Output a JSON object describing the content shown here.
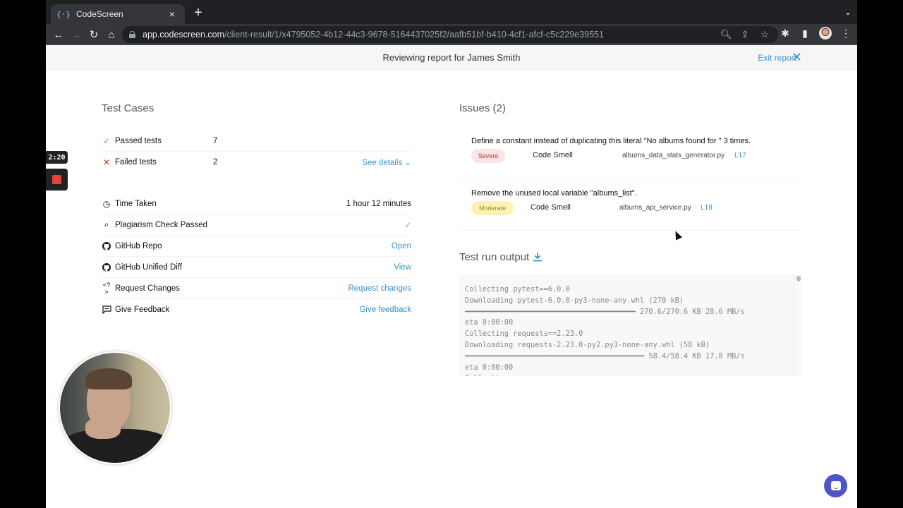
{
  "browser": {
    "tab": {
      "favicon": "{·}",
      "title": "CodeScreen"
    },
    "url_host": "app.codescreen.com",
    "url_path": "/client-result/1/x4795052-4b12-44c3-9678-5164437025f2/aafb51bf-b410-4cf1-afcf-c5c229e39551",
    "nav": {
      "back": "←",
      "forward": "→",
      "reload": "↻",
      "home": "⌂"
    },
    "omnibox_icons": {
      "zoom": "🔍︎",
      "share": "⇪",
      "bookmark": "☆"
    },
    "toolbar_icons": {
      "extensions": "✱",
      "sidepanel": "▮",
      "menu": "⋮"
    },
    "new_tab": "+",
    "tab_menu": "⌄",
    "tab_close": "×"
  },
  "banner": {
    "text": "Reviewing report for James Smith",
    "exit_label": "Exit report",
    "close_glyph": "✕"
  },
  "test_cases": {
    "title": "Test Cases",
    "rows": [
      {
        "icon": "✓",
        "label": "Passed tests",
        "count": "7"
      },
      {
        "icon": "✕",
        "label": "Failed tests",
        "count": "2",
        "action": "See details ⌄"
      }
    ]
  },
  "details": [
    {
      "icon": "clock-icon",
      "glyph": "◷",
      "label": "Time Taken",
      "value": "1 hour 12 minutes",
      "type": "value"
    },
    {
      "icon": "search-icon",
      "glyph": "⌕",
      "label": "Plagiarism Check Passed",
      "value": "✓",
      "type": "check"
    },
    {
      "icon": "github-icon",
      "glyph": "",
      "label": "GitHub Repo",
      "value": "Open",
      "type": "link"
    },
    {
      "icon": "github-icon",
      "glyph": "",
      "label": "GitHub Unified Diff",
      "value": "View",
      "type": "link"
    },
    {
      "icon": "request-changes-icon",
      "glyph": "<?>",
      "label": "Request Changes",
      "value": "Request changes",
      "type": "link"
    },
    {
      "icon": "feedback-icon",
      "glyph": "",
      "label": "Give Feedback",
      "value": "Give feedback",
      "type": "link"
    }
  ],
  "issues": {
    "title": "Issues (2)",
    "items": [
      {
        "message": "Define a constant instead of duplicating this literal \"No albums found for \" 3 times.",
        "severity": "Severe",
        "type": "Code Smell",
        "file": "albums_data_stats_generator.py",
        "line": "L17"
      },
      {
        "message": "Remove the unused local variable \"albums_list\".",
        "severity": "Moderate",
        "type": "Code Smell",
        "file": "albums_api_service.py",
        "line": "L18"
      }
    ]
  },
  "test_output": {
    "title": "Test run output",
    "lines": "Collecting pytest==6.0.0\nDownloading pytest-6.0.0-py3-none-any.whl (270 kB)\n━━━━━━━━━━━━━━━━━━━━━━━━━━━━━━━━━━━━━━━ 270.6/270.6 KB 28.6 MB/s\neta 0:00:00\nCollecting requests==2.23.0\nDownloading requests-2.23.0-py2.py3-none-any.whl (58 kB)\n━━━━━━━━━━━━━━━━━━━━━━━━━━━━━━━━━━━━━━━━━ 58.4/58.4 KB 17.8 MB/s\neta 0:00:00\nCollecting ..."
  },
  "recorder": {
    "time": "2:20"
  },
  "colors": {
    "accent": "#3b93c7",
    "pass": "#5cb85c",
    "fail": "#c0392b",
    "severe_bg": "#fbe4e6",
    "moderate_bg": "#fbf3b5",
    "chat": "#4d55c8"
  }
}
